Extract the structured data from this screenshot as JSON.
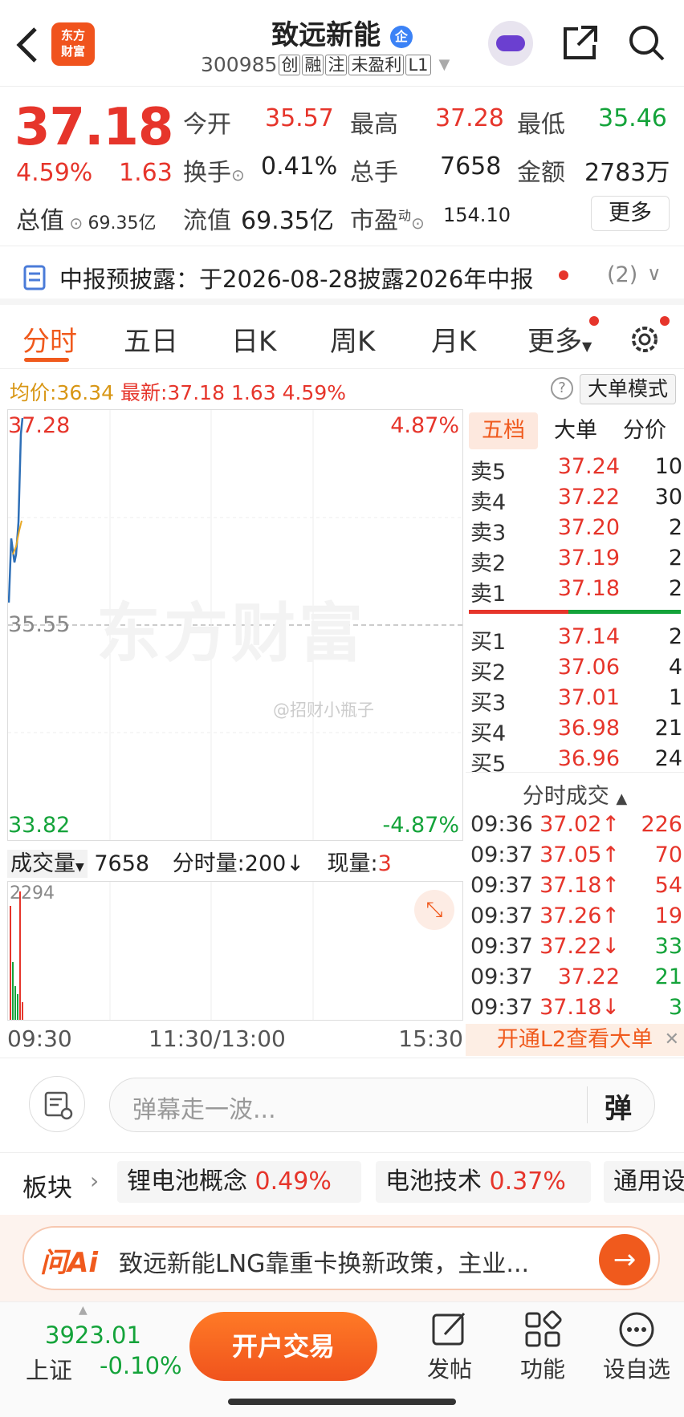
{
  "header": {
    "stock_name": "致远新能",
    "badge": "企",
    "code": "300985",
    "tags": [
      "创",
      "融",
      "注",
      "未盈利",
      "L1"
    ]
  },
  "logo_text": [
    "东方",
    "财富"
  ],
  "quote": {
    "price": "37.18",
    "change_pct": "4.59%",
    "change": "1.63",
    "open_label": "今开",
    "open": "35.57",
    "high_label": "最高",
    "high": "37.28",
    "low_label": "最低",
    "low": "35.46",
    "turnover_label": "换手",
    "turnover": "0.41%",
    "vol_label": "总手",
    "vol": "7658",
    "amount_label": "金额",
    "amount": "2783万",
    "mktcap_label": "总值",
    "mktcap": "69.35亿",
    "float_label": "流值",
    "float": "69.35亿",
    "pe_label": "市盈",
    "pe_sup": "动",
    "pe": "154.10",
    "more": "更多"
  },
  "notice": {
    "text": "中报预披露：于2026-08-28披露2026年中报",
    "count": "(2)"
  },
  "tabs": [
    "分时",
    "五日",
    "日K",
    "周K",
    "月K",
    "更多"
  ],
  "chart": {
    "avg_label": "均价:",
    "avg": "36.34",
    "latest_label": "最新:",
    "latest": "37.18",
    "chg": "1.63",
    "pct": "4.59%",
    "mode_btn": "大单模式",
    "top_price": "37.28",
    "top_pct": "4.87%",
    "mid_price": "35.55",
    "bot_price": "33.82",
    "bot_pct": "-4.87%",
    "watermark": "东方财富",
    "weibo": "@招财小瓶子",
    "vol_label": "成交量",
    "vol_value": "7658",
    "period_vol": "分时量:200↓",
    "cur_vol_label": "现量:",
    "cur_vol": "3",
    "vol_max": "2294",
    "time_start": "09:30",
    "time_mid": "11:30/13:00",
    "time_end": "15:30"
  },
  "orderbook": {
    "tabs": [
      "五档",
      "大单",
      "分价"
    ],
    "asks": [
      {
        "l": "卖5",
        "p": "37.24",
        "v": "10"
      },
      {
        "l": "卖4",
        "p": "37.22",
        "v": "30"
      },
      {
        "l": "卖3",
        "p": "37.20",
        "v": "2"
      },
      {
        "l": "卖2",
        "p": "37.19",
        "v": "2"
      },
      {
        "l": "卖1",
        "p": "37.18",
        "v": "2"
      }
    ],
    "bids": [
      {
        "l": "买1",
        "p": "37.14",
        "v": "2"
      },
      {
        "l": "买2",
        "p": "37.06",
        "v": "4"
      },
      {
        "l": "买3",
        "p": "37.01",
        "v": "1"
      },
      {
        "l": "买4",
        "p": "36.98",
        "v": "21"
      },
      {
        "l": "买5",
        "p": "36.96",
        "v": "24"
      }
    ],
    "ticks_title": "分时成交",
    "ticks": [
      {
        "t": "09:36",
        "p": "37.02↑",
        "v": "226",
        "d": "up"
      },
      {
        "t": "09:37",
        "p": "37.05↑",
        "v": "70",
        "d": "up"
      },
      {
        "t": "09:37",
        "p": "37.18↑",
        "v": "54",
        "d": "up"
      },
      {
        "t": "09:37",
        "p": "37.26↑",
        "v": "19",
        "d": "up"
      },
      {
        "t": "09:37",
        "p": "37.22↓",
        "v": "33",
        "d": "down"
      },
      {
        "t": "09:37",
        "p": "37.22",
        "v": "21",
        "d": "flat"
      },
      {
        "t": "09:37",
        "p": "37.18↓",
        "v": "3",
        "d": "down"
      }
    ],
    "l2_banner": "开通L2查看大单"
  },
  "danmaku": {
    "placeholder": "弹幕走一波...",
    "btn": "弹"
  },
  "sectors": {
    "label": "板块",
    "items": [
      {
        "name": "锂电池概念",
        "pct": "0.49%"
      },
      {
        "name": "电池技术",
        "pct": "0.37%"
      },
      {
        "name": "通用设"
      }
    ]
  },
  "ai": {
    "brand": "问Ai",
    "text": "致远新能LNG靠重卡换新政策，主业..."
  },
  "bottom": {
    "index_value": "3923.01",
    "index_name": "上证",
    "index_pct": "-0.10%",
    "trade_btn": "开户交易",
    "post": "发帖",
    "func": "功能",
    "watch": "设自选"
  }
}
